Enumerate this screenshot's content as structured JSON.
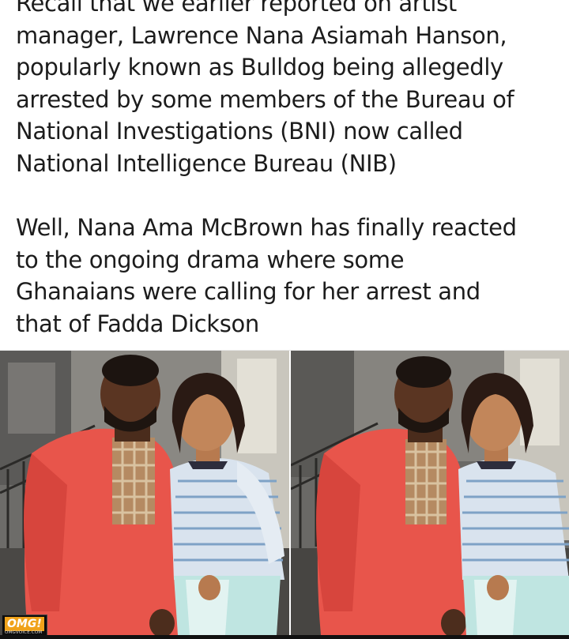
{
  "post": {
    "lines": [
      "Recall that we earlier reported on artist",
      "manager, Lawrence Nana Asiamah Hanson,",
      "popularly known as Bulldog being allegedly",
      "arrested by some members of the Bureau of",
      "National Investigations (BNI) now called",
      "National Intelligence Bureau (NIB)",
      "Well, Nana Ama McBrown has finally reacted",
      "to the ongoing drama where some",
      "Ghanaians were calling for her arrest and",
      "that of Fadda Dickson"
    ]
  },
  "image": {
    "watermark_main": "OMG!",
    "watermark_sub": "OMGVOICE.COM"
  }
}
